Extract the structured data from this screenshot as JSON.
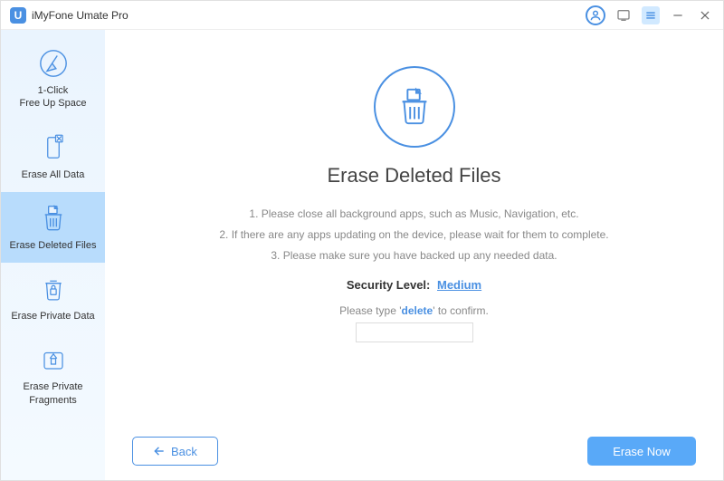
{
  "app": {
    "title": "iMyFone Umate Pro"
  },
  "sidebar": {
    "items": [
      {
        "label": "1-Click\nFree Up Space"
      },
      {
        "label": "Erase All Data"
      },
      {
        "label": "Erase Deleted Files"
      },
      {
        "label": "Erase Private Data"
      },
      {
        "label": "Erase Private\nFragments"
      }
    ]
  },
  "page": {
    "title": "Erase Deleted Files",
    "instructions": [
      "1. Please close all background apps, such as Music, Navigation, etc.",
      "2. If there are any apps updating on the device, please wait for them to complete.",
      "3. Please make sure you have backed up any needed data."
    ],
    "security_label": "Security Level:",
    "security_value": "Medium",
    "confirm_prefix": "Please type '",
    "confirm_keyword": "delete",
    "confirm_suffix": "' to confirm.",
    "confirm_value": ""
  },
  "footer": {
    "back": "Back",
    "erase": "Erase Now"
  }
}
